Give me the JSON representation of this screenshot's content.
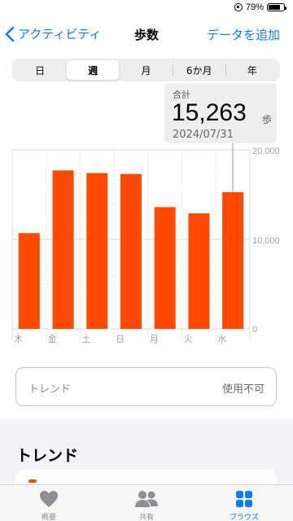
{
  "status_bar": {
    "battery": "79%",
    "battery_level": 0.79
  },
  "nav": {
    "back_label": "アクティビティ",
    "title": "歩数",
    "add_label": "データを追加"
  },
  "segments": [
    {
      "label": "日",
      "active": false
    },
    {
      "label": "週",
      "active": true
    },
    {
      "label": "月",
      "active": false
    },
    {
      "label": "6か月",
      "active": false
    },
    {
      "label": "年",
      "active": false
    }
  ],
  "callout": {
    "label": "合計",
    "value": "15,263",
    "unit": "歩",
    "date": "2024/07/31"
  },
  "chart_data": {
    "type": "bar",
    "categories": [
      "木",
      "金",
      "土",
      "日",
      "月",
      "火",
      "水"
    ],
    "values": [
      10700,
      17700,
      17400,
      17300,
      13600,
      12900,
      15263
    ],
    "ylim": [
      0,
      20000
    ],
    "yticks": [
      "0",
      "10,000",
      "20,000"
    ],
    "bar_color": "#ff4a00",
    "selected_index": 6,
    "grid": true
  },
  "trend_card": {
    "label": "トレンド",
    "value": "使用不可"
  },
  "section": {
    "title": "トレンド"
  },
  "tabs": [
    {
      "label": "概要",
      "icon": "heart-icon",
      "active": false
    },
    {
      "label": "共有",
      "icon": "people-icon",
      "active": false
    },
    {
      "label": "ブラウズ",
      "icon": "grid-icon",
      "active": true
    }
  ],
  "colors": {
    "accent": "#0a7aff",
    "bar": "#ff4a00"
  }
}
